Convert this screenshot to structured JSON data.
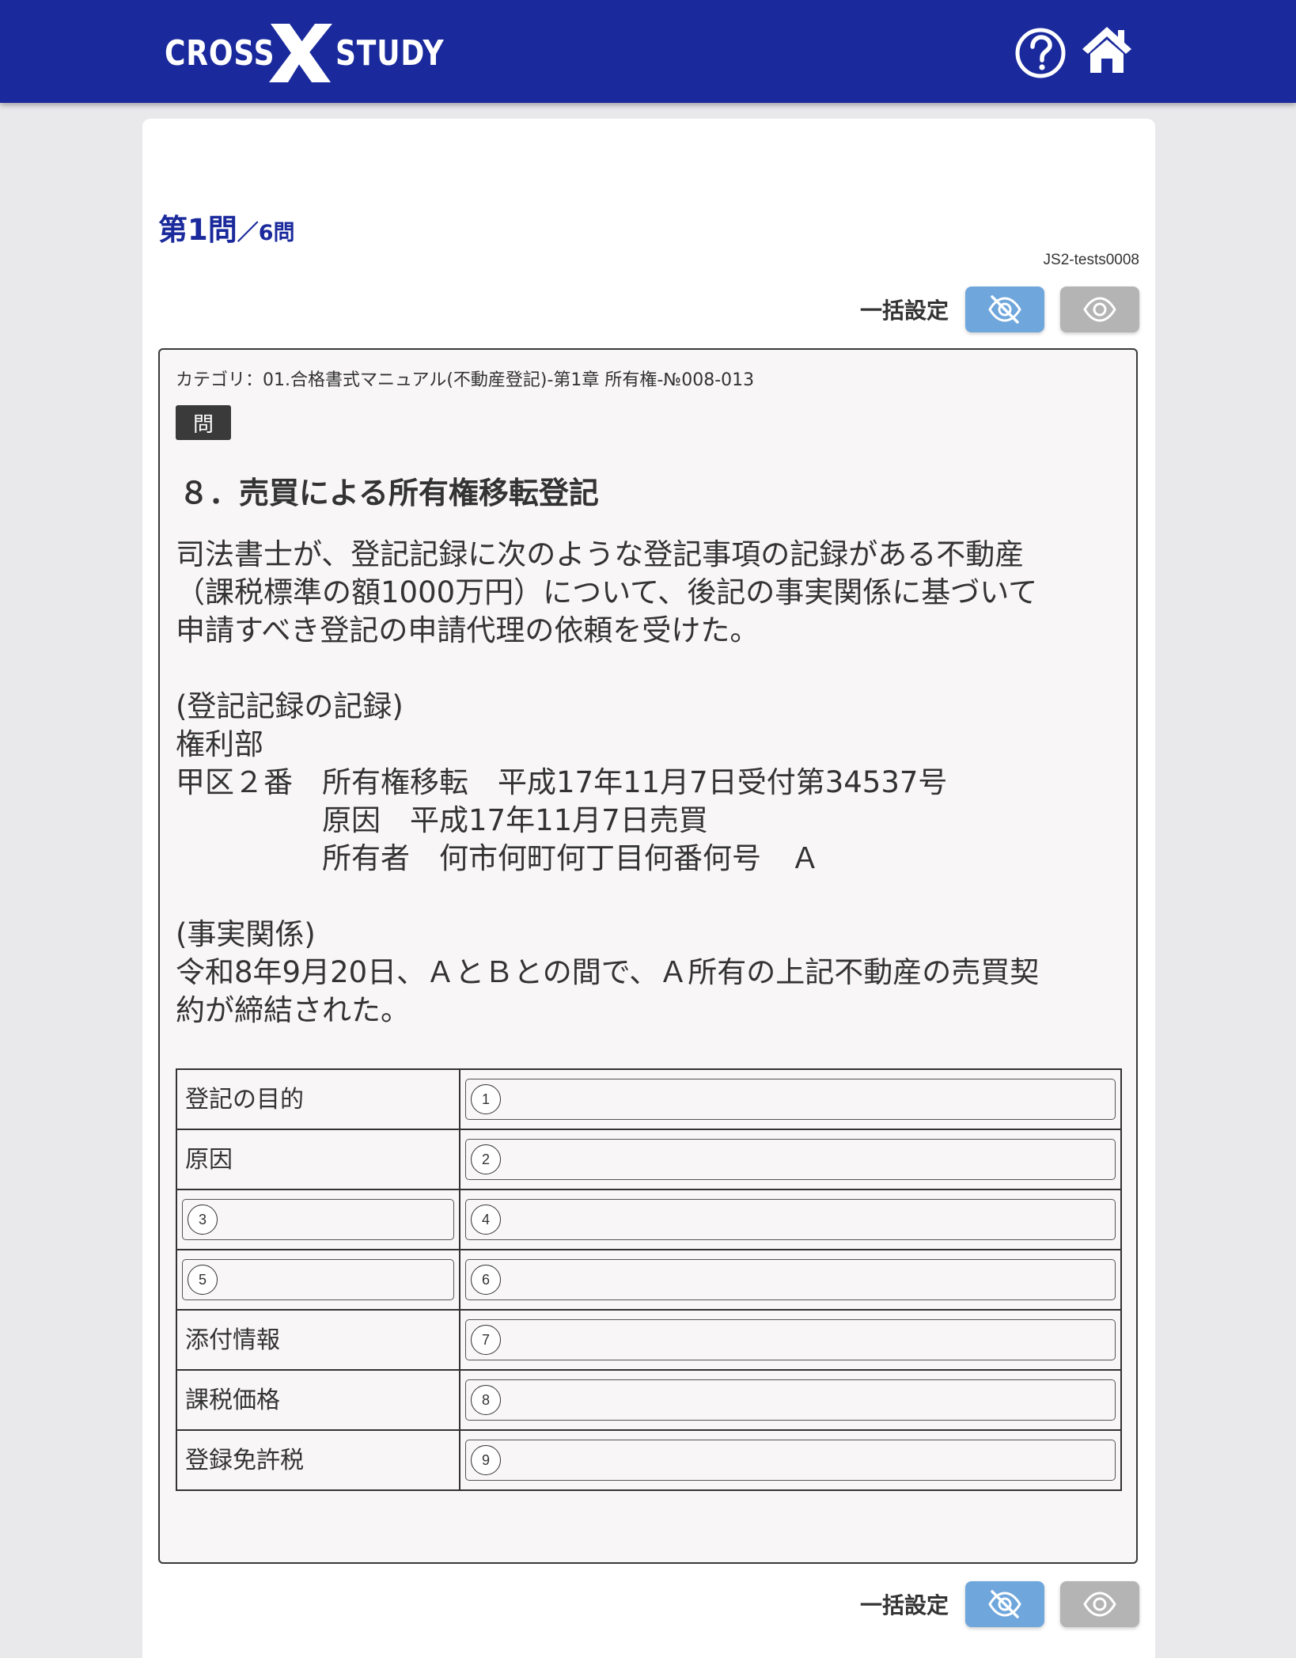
{
  "header": {
    "logo_left": "CROSS",
    "logo_right": "STUDY",
    "help_icon": "help-circle-icon",
    "home_icon": "home-icon",
    "brand_color": "#1a2a9c"
  },
  "question": {
    "number": "第1問",
    "total": "／6問",
    "test_id": "JS2-tests0008",
    "bulk_label": "一括設定",
    "hide_icon": "eye-off-icon",
    "show_icon": "eye-icon",
    "category": "カテゴリ：01.合格書式マニュアル(不動産登記)-第1章 所有権-№008-013",
    "badge": "問",
    "heading": "８．売買による所有権移転登記",
    "body": "司法書士が、登記記録に次のような登記事項の記録がある不動産\n（課税標準の額1000万円）について、後記の事実関係に基づいて\n申請すべき登記の申請代理の依頼を受けた。\n\n(登記記録の記録)\n権利部\n甲区２番　所有権移転　平成17年11月7日受付第34537号\n　　　　　原因　平成17年11月7日売買\n　　　　　所有者　何市何町何丁目何番何号　Ａ\n\n(事実関係)\n令和8年9月20日、ＡとＢとの間で、Ａ所有の上記不動産の売買契\n約が締結された。"
  },
  "table": {
    "rows": [
      {
        "label": "登記の目的",
        "num": "1"
      },
      {
        "label": "原因",
        "num": "2"
      },
      {
        "label_num": "3",
        "num": "4"
      },
      {
        "label_num": "5",
        "num": "6"
      },
      {
        "label": "添付情報",
        "num": "7"
      },
      {
        "label": "課税価格",
        "num": "8"
      },
      {
        "label": "登録免許税",
        "num": "9"
      }
    ]
  }
}
